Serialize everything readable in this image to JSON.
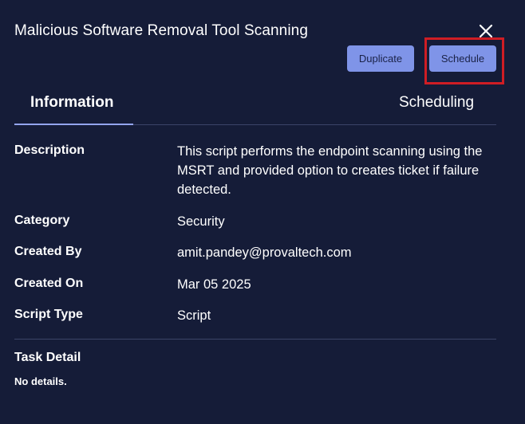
{
  "dialog": {
    "title": "Malicious Software Removal Tool Scanning",
    "close_icon": "close-icon"
  },
  "actions": {
    "duplicate_label": "Duplicate",
    "schedule_label": "Schedule"
  },
  "tabs": [
    {
      "label": "Information",
      "active": true
    },
    {
      "label": "Scheduling",
      "active": false
    }
  ],
  "details": {
    "description": {
      "label": "Description",
      "value": "This script performs the endpoint scanning using the MSRT and provided option to creates ticket if failure detected."
    },
    "category": {
      "label": "Category",
      "value": "Security"
    },
    "created_by": {
      "label": "Created By",
      "value": "amit.pandey@provaltech.com"
    },
    "created_on": {
      "label": "Created On",
      "value": "Mar 05 2025"
    },
    "script_type": {
      "label": "Script Type",
      "value": "Script"
    }
  },
  "task_detail": {
    "title": "Task Detail",
    "body": "No details."
  },
  "colors": {
    "background": "#151c38",
    "button": "#7f94e8",
    "button_text": "#1a2247",
    "highlight": "#cf1d24",
    "tab_indicator": "#93a4ee"
  }
}
